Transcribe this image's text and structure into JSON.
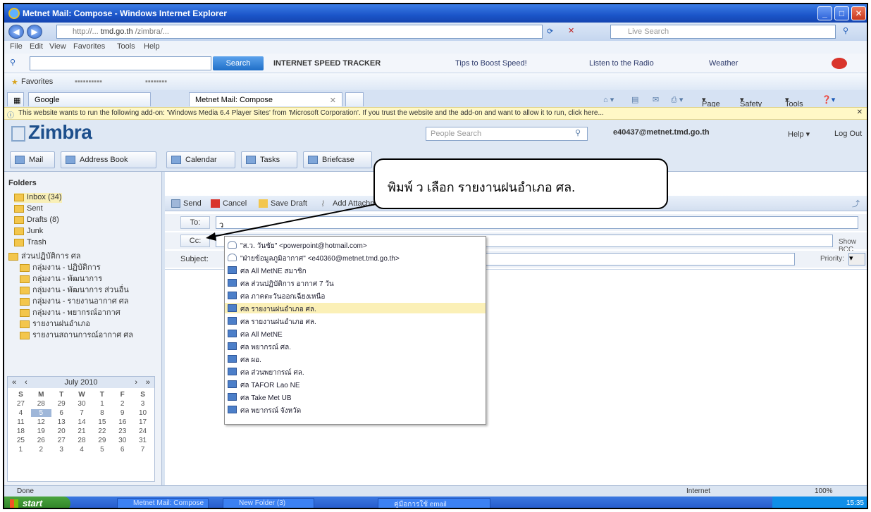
{
  "window": {
    "title": "Metnet Mail: Compose - Windows Internet Explorer",
    "address_domain": "tmd.go.th",
    "search_placeholder": "Live Search"
  },
  "menu": [
    "File",
    "Edit",
    "View",
    "Favorites",
    "Tools",
    "Help"
  ],
  "toolbar": {
    "search_label": "Search",
    "speed_tracker": "INTERNET SPEED TRACKER",
    "links": [
      "Tips to Boost Speed!",
      "Listen to the Radio",
      "Weather"
    ]
  },
  "favorites": {
    "label": "Favorites"
  },
  "tabs": {
    "google": "Google",
    "active": "Metnet Mail: Compose"
  },
  "commandbar": [
    "Page",
    "Safety",
    "Tools"
  ],
  "infobar": "This website wants to run the following add-on: 'Windows Media 6.4 Player Sites' from 'Microsoft Corporation'. If you trust the website and the add-on and want to allow it to run, click here...",
  "zimbra": {
    "logo": "Zimbra",
    "people_search": "People Search",
    "user": "e40437@metnet.tmd.go.th",
    "help": "Help",
    "logout": "Log Out",
    "apps": [
      "Mail",
      "Address Book",
      "Calendar",
      "Tasks",
      "Briefcase"
    ]
  },
  "folders": {
    "header": "Folders",
    "items": [
      {
        "label": "Inbox (34)",
        "selected": true
      },
      {
        "label": "Sent"
      },
      {
        "label": "Drafts (8)"
      },
      {
        "label": "Junk"
      },
      {
        "label": "Trash"
      },
      {
        "label": "ส่วนปฏิบัติการ ศล"
      },
      {
        "label": "กลุ่มงาน - ปฏิบัติการ"
      },
      {
        "label": "กลุ่มงาน - พัฒนาการ"
      },
      {
        "label": "กลุ่มงาน - พัฒนาการ ส่วนอื่น"
      },
      {
        "label": "กลุ่มงาน - รายงานอากาศ ศล"
      },
      {
        "label": "กลุ่มงาน - พยากรณ์อากาศ"
      },
      {
        "label": "รายงานฝนอำเภอ"
      },
      {
        "label": "รายงานสถานการณ์อากาศ ศล"
      }
    ]
  },
  "calendar": {
    "month": "July 2010",
    "days": [
      "S",
      "M",
      "T",
      "W",
      "T",
      "F",
      "S"
    ],
    "dates": [
      "27",
      "28",
      "29",
      "30",
      "1",
      "2",
      "3",
      "4",
      "5",
      "6",
      "7",
      "8",
      "9",
      "10",
      "11",
      "12",
      "13",
      "14",
      "15",
      "16",
      "17",
      "18",
      "19",
      "20",
      "21",
      "22",
      "23",
      "24",
      "25",
      "26",
      "27",
      "28",
      "29",
      "30",
      "31",
      "1",
      "2",
      "3",
      "4",
      "5",
      "6",
      "7"
    ],
    "today": "5"
  },
  "compose": {
    "buttons": [
      "Send",
      "Cancel",
      "Save Draft",
      "Add Attachment"
    ],
    "to_label": "To:",
    "to_value": "ว",
    "cc_label": "Cc:",
    "subject_label": "Subject:",
    "show_bcc": "Show BCC",
    "priority": "Priority:"
  },
  "autocomplete": [
    {
      "label": "\"ส.ว. วันชัย\" <powerpoint@hotmail.com>",
      "type": "person"
    },
    {
      "label": "\"ฝ่ายข้อมูลภูมิอากาศ\" <e40360@metnet.tmd.go.th>",
      "type": "person"
    },
    {
      "label": "ศล All MetNE สมาชิก",
      "type": "group"
    },
    {
      "label": "ศล ส่วนปฏิบัติการ อากาศ 7 วัน",
      "type": "group"
    },
    {
      "label": "ศล ภาคตะวันออกเฉียงเหนือ",
      "type": "group"
    },
    {
      "label": "ศล รายงานฝนอำเภอ ศล.",
      "type": "group",
      "highlight": true
    },
    {
      "label": "ศล รายงานฝนอำเภอ ศล.",
      "type": "group"
    },
    {
      "label": "ศล All MetNE",
      "type": "group"
    },
    {
      "label": "ศล พยากรณ์ ศล.",
      "type": "group"
    },
    {
      "label": "ศล ผอ.",
      "type": "group"
    },
    {
      "label": "ศล ส่วนพยากรณ์ ศล.",
      "type": "group"
    },
    {
      "label": "ศล TAFOR Lao NE",
      "type": "group"
    },
    {
      "label": "ศล Take Met UB",
      "type": "group"
    },
    {
      "label": "ศล พยากรณ์ จังหวัด",
      "type": "group"
    }
  ],
  "callout": "พิมพ์ ว เลือก รายงานฝนอำเภอ ศล.",
  "status": {
    "left": "Done",
    "zone": "Internet",
    "zoom": "100%"
  },
  "taskbar": {
    "start": "start",
    "items": [
      "Metnet Mail: Compose",
      "New Folder (3)",
      "คู่มือการใช้ email"
    ],
    "clock": "15:35"
  }
}
